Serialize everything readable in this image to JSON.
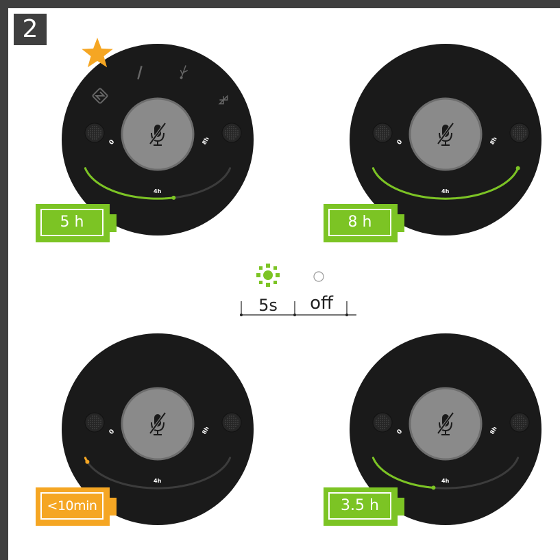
{
  "step_number": "2",
  "devices": [
    {
      "id": "top-left",
      "battery_label": "5 h",
      "battery_color": "#7cc424",
      "arc_fraction": 0.58,
      "arc_color": "#7cc424",
      "favorite": true,
      "show_top_icons": true,
      "scale_labels": {
        "zero": "0",
        "mid": "4h",
        "max": "8h"
      }
    },
    {
      "id": "top-right",
      "battery_label": "8 h",
      "battery_color": "#7cc424",
      "arc_fraction": 1.0,
      "arc_color": "#7cc424",
      "favorite": false,
      "show_top_icons": false,
      "scale_labels": {
        "zero": "0",
        "mid": "4h",
        "max": "8h"
      }
    },
    {
      "id": "bottom-left",
      "battery_label": "<10min",
      "battery_color": "#f5a623",
      "arc_fraction": 0.04,
      "arc_color": "#f5a623",
      "favorite": false,
      "show_top_icons": false,
      "scale_labels": {
        "zero": "0",
        "mid": "4h",
        "max": "8h"
      }
    },
    {
      "id": "bottom-right",
      "battery_label": "3.5 h",
      "battery_color": "#7cc424",
      "arc_fraction": 0.44,
      "arc_color": "#7cc424",
      "favorite": false,
      "show_top_icons": false,
      "scale_labels": {
        "zero": "0",
        "mid": "4h",
        "max": "8h"
      }
    }
  ],
  "legend": {
    "on_label": "5s",
    "off_label": "off",
    "on_color": "#7cc424"
  },
  "icons": [
    "star-icon",
    "nfc-icon",
    "wired-icon",
    "usb-icon",
    "bluetooth-icon",
    "mic-mute-icon",
    "led-on-icon",
    "led-off-icon"
  ]
}
